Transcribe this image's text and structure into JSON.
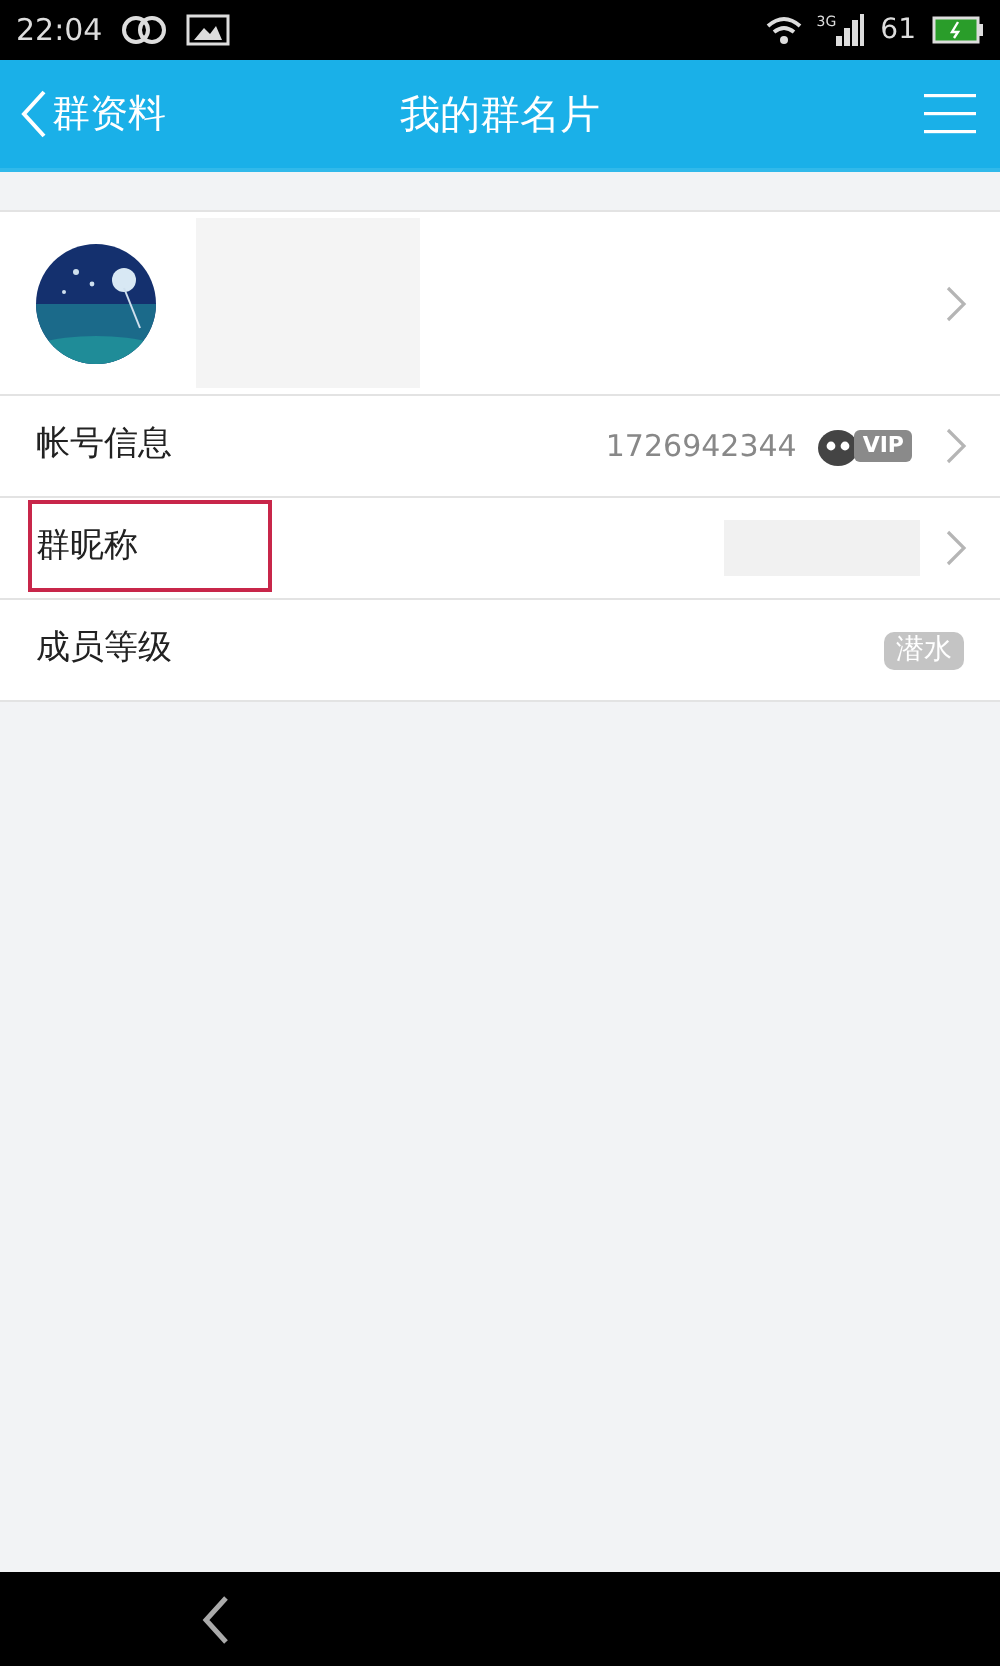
{
  "status_bar": {
    "time": "22:04",
    "network": "3G",
    "battery": "61"
  },
  "header": {
    "back_label": "群资料",
    "title": "我的群名片"
  },
  "rows": [
    {
      "kind": "profile"
    },
    {
      "kind": "value",
      "label": "帐号信息",
      "value": "1726942344",
      "badge": "VIP",
      "highlighted": false
    },
    {
      "kind": "redacted",
      "label": "群昵称",
      "highlighted": true
    },
    {
      "kind": "tag",
      "label": "成员等级",
      "tag": "潜水",
      "highlighted": false
    }
  ]
}
